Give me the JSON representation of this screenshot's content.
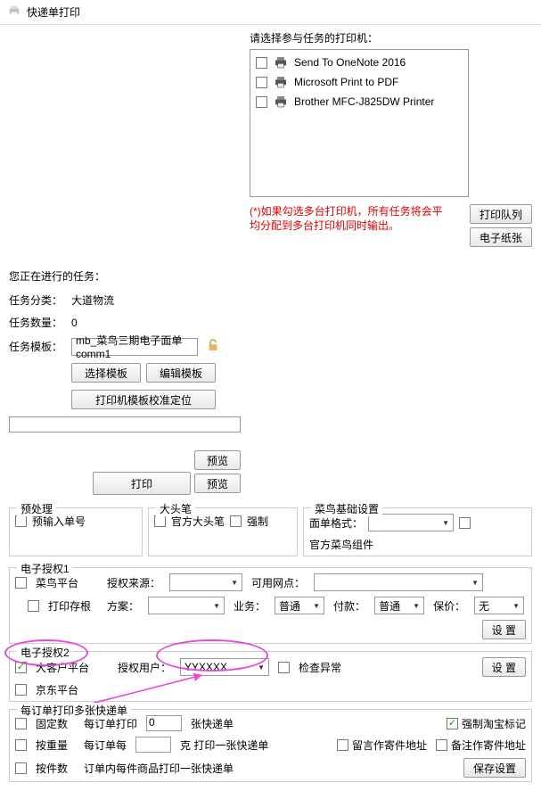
{
  "title": "快递单打印",
  "printer_header": "请选择参与任务的打印机：",
  "left": {
    "running_label": "您正在进行的任务：",
    "category_label": "任务分类：",
    "category_value": "大道物流",
    "count_label": "任务数量：",
    "count_value": "0",
    "template_label": "任务模板：",
    "template_value": "mb_菜鸟三期电子面单comm1",
    "btn_select_template": "选择模板",
    "btn_edit_template": "编辑模板",
    "btn_calibrate": "打印机模板校准定位",
    "btn_print": "打印",
    "btn_preview": "预览"
  },
  "printers": [
    {
      "name": "Send To OneNote 2016"
    },
    {
      "name": "Microsoft Print to PDF"
    },
    {
      "name": "Brother MFC-J825DW Printer"
    }
  ],
  "multi_note_1": "(*)如果勾选多台打印机，所有任务将会平",
  "multi_note_2": "均分配到多台打印机同时输出。",
  "btn_queue": "打印队列",
  "btn_epaper": "电子纸张",
  "pre": {
    "legend": "预处理",
    "preinput": "预输入单号"
  },
  "pen": {
    "legend": "大头笔",
    "official": "官方大头笔",
    "force": "强制"
  },
  "cainiao": {
    "legend": "菜鸟基础设置",
    "format_label": "面单格式：",
    "official_comp": "官方菜鸟组件"
  },
  "auth1": {
    "legend": "电子授权1",
    "platform": "菜鸟平台",
    "source_label": "授权来源：",
    "outlets_label": "可用网点：",
    "print_stub": "打印存根",
    "plan_label": "方案：",
    "biz_label": "业务：",
    "biz_value": "普通",
    "pay_label": "付款：",
    "pay_value": "普通",
    "ins_label": "保价：",
    "ins_value": "无",
    "btn_set": "设 置"
  },
  "auth2": {
    "legend": "电子授权2",
    "bigclient": "大客户平台",
    "user_label": "授权用户：",
    "user_value": "YYXXXX",
    "check_abnormal": "检查异常",
    "jd": "京东平台",
    "btn_set": "设 置"
  },
  "multi": {
    "legend": "每订单打印多张快递单",
    "fixed": "固定数",
    "per_order_label": "每订单打印",
    "per_order_value": "0",
    "unit_sheets": "张快递单",
    "force_tb": "强制淘宝标记",
    "by_weight": "按重量",
    "per_order_each": "每订单每",
    "gram": "克 打印一张快递单",
    "leave_addr": "留言作寄件地址",
    "note_addr": "备注作寄件地址",
    "by_pieces": "按件数",
    "per_piece_rule": "订单内每件商品打印一张快递单",
    "btn_save": "保存设置"
  }
}
